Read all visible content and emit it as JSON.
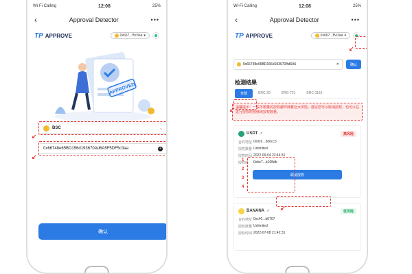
{
  "status": {
    "carrier": "Wi-Fi Calling",
    "time": "12:08",
    "battery": "25%"
  },
  "nav": {
    "title": "Approval Detector",
    "back": "‹",
    "more": "•••"
  },
  "brand": {
    "tp": "TP",
    "name": "APPROVE"
  },
  "wallet": {
    "address": "0x667...f5c3aa",
    "address_left": "0x667...f5c3aa",
    "status_color": "#1fc47a"
  },
  "illustration": {
    "stamp": "APPROVED"
  },
  "left": {
    "chain_name": "BSC",
    "address_input": "0x66748e65BD156d193670Ad6A5F5DF5c3aa",
    "confirm_label": "确认"
  },
  "right": {
    "search_value": "0x66748e65BD156d193670Ad6A5",
    "search_clear": "✕",
    "confirm_label": "确认",
    "section_title": "检测结果",
    "tabs": [
      "全部",
      "ERC-20",
      "ERC-721",
      "ERC-1155"
    ],
    "warning": "温馨提示：一般不限量的授权都伴随着巨大风险，建议您可以取消授权，也可以在进行授权时候修改授权数量。",
    "cards": [
      {
        "token": "USDT",
        "risk": "高风险",
        "rows": [
          {
            "k": "合约地址",
            "v": "0x9c9...3d6cc3"
          },
          {
            "k": "授权数量",
            "v": "Unlimited"
          },
          {
            "k": "授权时间",
            "v": "2022-09-04 22:44:31"
          },
          {
            "k": "授权给",
            "v": "0xbe7...b168db"
          }
        ],
        "action": "取消授权"
      },
      {
        "token": "BANANA",
        "risk": "低风险",
        "rows": [
          {
            "k": "合约地址",
            "v": "0xc40...b0707"
          },
          {
            "k": "授权数量",
            "v": "Unlimited"
          },
          {
            "k": "授权时间",
            "v": "2022-07-08 21:42:31"
          }
        ]
      }
    ],
    "markers": [
      "1",
      "2",
      "3",
      "4"
    ]
  },
  "colors": {
    "accent": "#2c7be5",
    "danger": "#e53935",
    "success": "#1fa862"
  }
}
